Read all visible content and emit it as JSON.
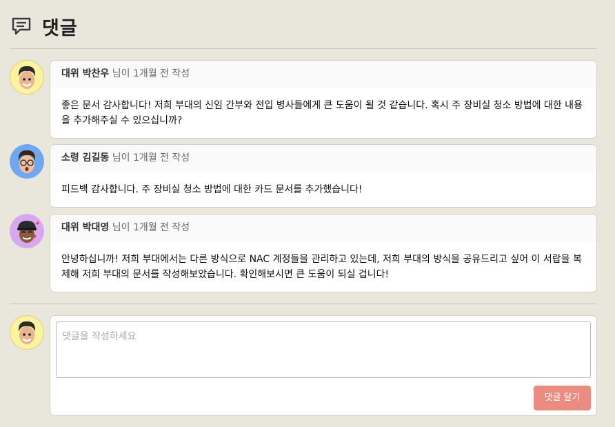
{
  "header": {
    "title": "댓글",
    "icon": "comment-icon"
  },
  "comments": [
    {
      "author": "대위 박찬우",
      "meta_suffix": " 님이 1개월 전 작성",
      "text": "좋은 문서 감사합니다! 저희 부대의 신임 간부와 전입 병사들에게 큰 도움이 될 것 같습니다. 혹시 주 장비실 청소 방법에 대한 내용을 추가해주실 수 있으십니까?",
      "avatar_bg": "#fbf3a0"
    },
    {
      "author": "소령 김길동",
      "meta_suffix": " 님이 1개월 전 작성",
      "text": "피드백 감사합니다. 주 장비실 청소 방법에 대한 카드 문서를 추가했습니다!",
      "avatar_bg": "#6fa8f0"
    },
    {
      "author": "대위 박대영",
      "meta_suffix": " 님이 1개월 전 작성",
      "text": "안녕하십니까! 저희 부대에서는 다른 방식으로 NAC 계정들을 관리하고 있는데, 저희 부대의 방식을 공유드리고 싶어 이 서랍을 복제해 저희 부대의 문서를 작성해보았습니다. 확인해보시면 큰 도움이 되실 겁니다!",
      "avatar_bg": "#d7a8f0"
    }
  ],
  "composer": {
    "placeholder": "댓글을 작성하세요",
    "submit_label": "댓글 달기",
    "avatar_bg": "#fbf3a0"
  },
  "colors": {
    "background": "#e9e6dc",
    "submit": "#ea8c80"
  }
}
